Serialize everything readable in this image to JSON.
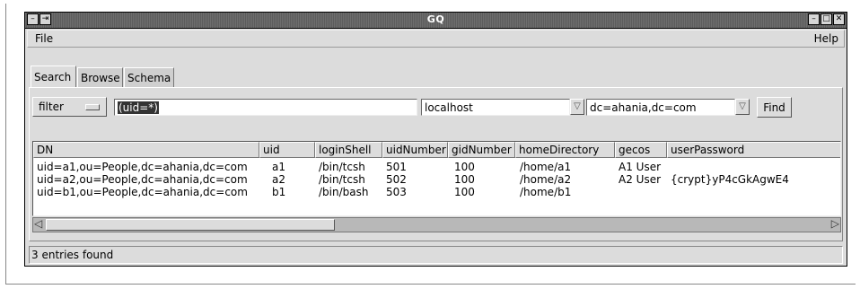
{
  "window": {
    "title": "GQ",
    "minimize_glyph": "–",
    "maximize_glyph": "□",
    "close_glyph": "✕",
    "menu_glyph": "–",
    "pin_glyph": "⇥"
  },
  "menubar": {
    "file": "File",
    "help": "Help"
  },
  "tabs": [
    {
      "label": "Search",
      "active": true
    },
    {
      "label": "Browse",
      "active": false
    },
    {
      "label": "Schema",
      "active": false
    }
  ],
  "search": {
    "mode_label": "filter",
    "query_value": "(uid=*)",
    "server_value": "localhost",
    "base_dn_value": "dc=ahania,dc=com",
    "find_label": "Find",
    "dropdown_glyph": "▽"
  },
  "results": {
    "columns": [
      "DN",
      "uid",
      "loginShell",
      "uidNumber",
      "gidNumber",
      "homeDirectory",
      "gecos",
      "userPassword"
    ],
    "rows": [
      [
        "uid=a1,ou=People,dc=ahania,dc=com",
        "a1",
        "/bin/tcsh",
        "501",
        "100",
        "/home/a1",
        "A1 User",
        ""
      ],
      [
        "uid=a2,ou=People,dc=ahania,dc=com",
        "a2",
        "/bin/tcsh",
        "502",
        "100",
        "/home/a2",
        "A2 User",
        "{crypt}yP4cGkAgwE4"
      ],
      [
        "uid=b1,ou=People,dc=ahania,dc=com",
        "b1",
        "/bin/bash",
        "503",
        "100",
        "/home/b1",
        "",
        ""
      ]
    ]
  },
  "scrollbar": {
    "left_glyph": "◁",
    "right_glyph": "▷",
    "position": 0,
    "visible_fraction": 0.37
  },
  "status": {
    "text": "3 entries found"
  }
}
